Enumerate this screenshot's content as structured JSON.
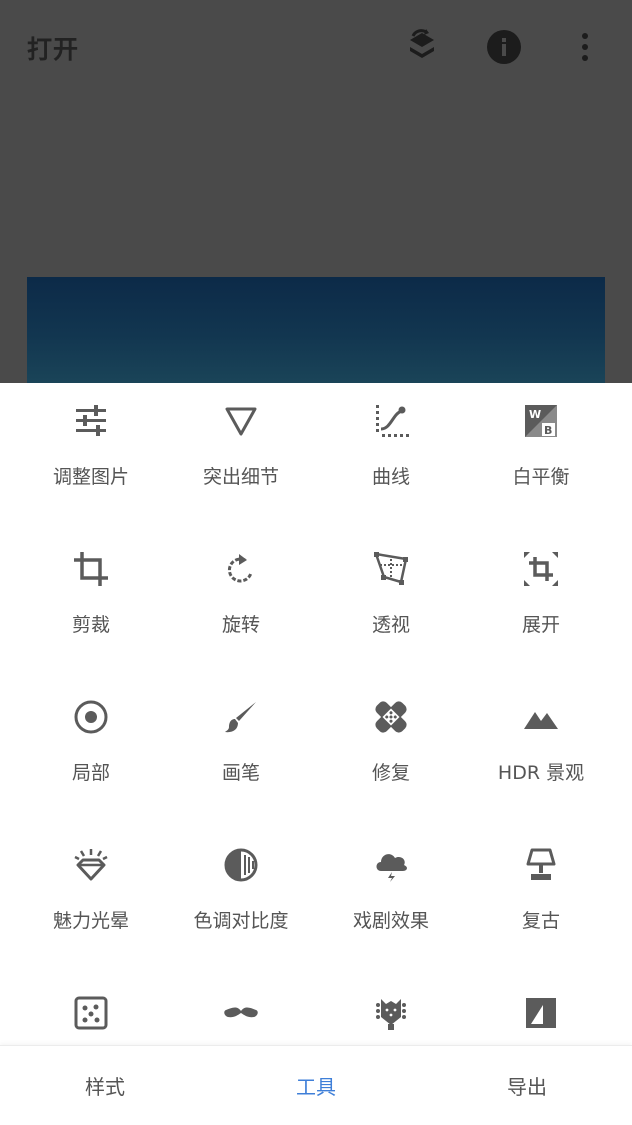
{
  "header": {
    "title": "打开"
  },
  "tools": [
    {
      "label": "调整图片",
      "icon": "tune-icon"
    },
    {
      "label": "突出细节",
      "icon": "triangle-down-icon"
    },
    {
      "label": "曲线",
      "icon": "curves-icon"
    },
    {
      "label": "白平衡",
      "icon": "white-balance-icon"
    },
    {
      "label": "剪裁",
      "icon": "crop-icon"
    },
    {
      "label": "旋转",
      "icon": "rotate-icon"
    },
    {
      "label": "透视",
      "icon": "perspective-icon"
    },
    {
      "label": "展开",
      "icon": "expand-icon"
    },
    {
      "label": "局部",
      "icon": "selective-icon"
    },
    {
      "label": "画笔",
      "icon": "brush-icon"
    },
    {
      "label": "修复",
      "icon": "healing-icon"
    },
    {
      "label": "HDR 景观",
      "icon": "mountains-icon"
    },
    {
      "label": "魅力光晕",
      "icon": "glamour-glow-icon"
    },
    {
      "label": "色调对比度",
      "icon": "tonal-contrast-icon"
    },
    {
      "label": "戏剧效果",
      "icon": "drama-cloud-icon"
    },
    {
      "label": "复古",
      "icon": "lamp-icon"
    },
    {
      "label": "",
      "icon": "grainy-film-icon"
    },
    {
      "label": "",
      "icon": "mustache-icon"
    },
    {
      "label": "",
      "icon": "guitar-icon"
    },
    {
      "label": "",
      "icon": "noir-icon"
    }
  ],
  "bottom_nav": [
    {
      "label": "样式",
      "active": false
    },
    {
      "label": "工具",
      "active": true
    },
    {
      "label": "导出",
      "active": false
    }
  ],
  "colors": {
    "accent": "#3f7fd8",
    "icon": "#5b5b5b",
    "dim_overlay": "#4a4a4a"
  }
}
